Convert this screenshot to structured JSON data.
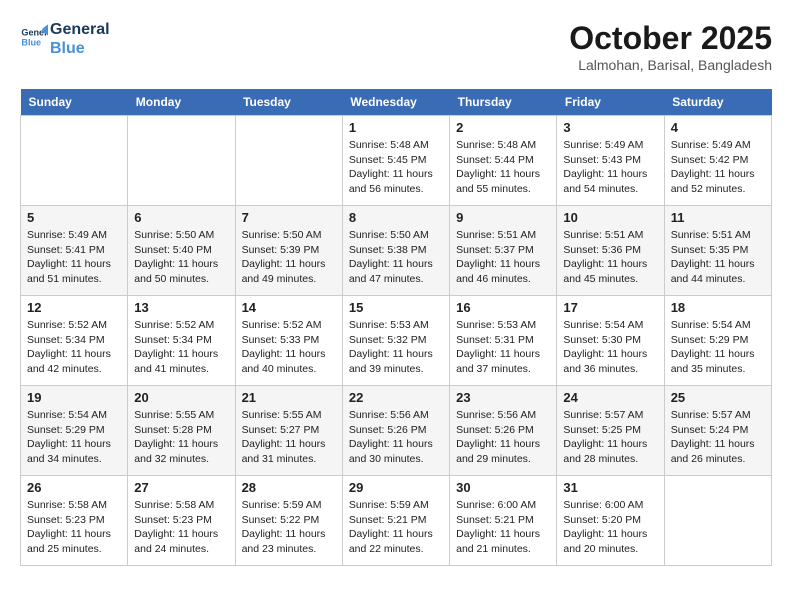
{
  "header": {
    "logo_line1": "General",
    "logo_line2": "Blue",
    "month": "October 2025",
    "location": "Lalmohan, Barisal, Bangladesh"
  },
  "weekdays": [
    "Sunday",
    "Monday",
    "Tuesday",
    "Wednesday",
    "Thursday",
    "Friday",
    "Saturday"
  ],
  "weeks": [
    [
      {
        "day": "",
        "info": ""
      },
      {
        "day": "",
        "info": ""
      },
      {
        "day": "",
        "info": ""
      },
      {
        "day": "1",
        "info": "Sunrise: 5:48 AM\nSunset: 5:45 PM\nDaylight: 11 hours\nand 56 minutes."
      },
      {
        "day": "2",
        "info": "Sunrise: 5:48 AM\nSunset: 5:44 PM\nDaylight: 11 hours\nand 55 minutes."
      },
      {
        "day": "3",
        "info": "Sunrise: 5:49 AM\nSunset: 5:43 PM\nDaylight: 11 hours\nand 54 minutes."
      },
      {
        "day": "4",
        "info": "Sunrise: 5:49 AM\nSunset: 5:42 PM\nDaylight: 11 hours\nand 52 minutes."
      }
    ],
    [
      {
        "day": "5",
        "info": "Sunrise: 5:49 AM\nSunset: 5:41 PM\nDaylight: 11 hours\nand 51 minutes."
      },
      {
        "day": "6",
        "info": "Sunrise: 5:50 AM\nSunset: 5:40 PM\nDaylight: 11 hours\nand 50 minutes."
      },
      {
        "day": "7",
        "info": "Sunrise: 5:50 AM\nSunset: 5:39 PM\nDaylight: 11 hours\nand 49 minutes."
      },
      {
        "day": "8",
        "info": "Sunrise: 5:50 AM\nSunset: 5:38 PM\nDaylight: 11 hours\nand 47 minutes."
      },
      {
        "day": "9",
        "info": "Sunrise: 5:51 AM\nSunset: 5:37 PM\nDaylight: 11 hours\nand 46 minutes."
      },
      {
        "day": "10",
        "info": "Sunrise: 5:51 AM\nSunset: 5:36 PM\nDaylight: 11 hours\nand 45 minutes."
      },
      {
        "day": "11",
        "info": "Sunrise: 5:51 AM\nSunset: 5:35 PM\nDaylight: 11 hours\nand 44 minutes."
      }
    ],
    [
      {
        "day": "12",
        "info": "Sunrise: 5:52 AM\nSunset: 5:34 PM\nDaylight: 11 hours\nand 42 minutes."
      },
      {
        "day": "13",
        "info": "Sunrise: 5:52 AM\nSunset: 5:34 PM\nDaylight: 11 hours\nand 41 minutes."
      },
      {
        "day": "14",
        "info": "Sunrise: 5:52 AM\nSunset: 5:33 PM\nDaylight: 11 hours\nand 40 minutes."
      },
      {
        "day": "15",
        "info": "Sunrise: 5:53 AM\nSunset: 5:32 PM\nDaylight: 11 hours\nand 39 minutes."
      },
      {
        "day": "16",
        "info": "Sunrise: 5:53 AM\nSunset: 5:31 PM\nDaylight: 11 hours\nand 37 minutes."
      },
      {
        "day": "17",
        "info": "Sunrise: 5:54 AM\nSunset: 5:30 PM\nDaylight: 11 hours\nand 36 minutes."
      },
      {
        "day": "18",
        "info": "Sunrise: 5:54 AM\nSunset: 5:29 PM\nDaylight: 11 hours\nand 35 minutes."
      }
    ],
    [
      {
        "day": "19",
        "info": "Sunrise: 5:54 AM\nSunset: 5:29 PM\nDaylight: 11 hours\nand 34 minutes."
      },
      {
        "day": "20",
        "info": "Sunrise: 5:55 AM\nSunset: 5:28 PM\nDaylight: 11 hours\nand 32 minutes."
      },
      {
        "day": "21",
        "info": "Sunrise: 5:55 AM\nSunset: 5:27 PM\nDaylight: 11 hours\nand 31 minutes."
      },
      {
        "day": "22",
        "info": "Sunrise: 5:56 AM\nSunset: 5:26 PM\nDaylight: 11 hours\nand 30 minutes."
      },
      {
        "day": "23",
        "info": "Sunrise: 5:56 AM\nSunset: 5:26 PM\nDaylight: 11 hours\nand 29 minutes."
      },
      {
        "day": "24",
        "info": "Sunrise: 5:57 AM\nSunset: 5:25 PM\nDaylight: 11 hours\nand 28 minutes."
      },
      {
        "day": "25",
        "info": "Sunrise: 5:57 AM\nSunset: 5:24 PM\nDaylight: 11 hours\nand 26 minutes."
      }
    ],
    [
      {
        "day": "26",
        "info": "Sunrise: 5:58 AM\nSunset: 5:23 PM\nDaylight: 11 hours\nand 25 minutes."
      },
      {
        "day": "27",
        "info": "Sunrise: 5:58 AM\nSunset: 5:23 PM\nDaylight: 11 hours\nand 24 minutes."
      },
      {
        "day": "28",
        "info": "Sunrise: 5:59 AM\nSunset: 5:22 PM\nDaylight: 11 hours\nand 23 minutes."
      },
      {
        "day": "29",
        "info": "Sunrise: 5:59 AM\nSunset: 5:21 PM\nDaylight: 11 hours\nand 22 minutes."
      },
      {
        "day": "30",
        "info": "Sunrise: 6:00 AM\nSunset: 5:21 PM\nDaylight: 11 hours\nand 21 minutes."
      },
      {
        "day": "31",
        "info": "Sunrise: 6:00 AM\nSunset: 5:20 PM\nDaylight: 11 hours\nand 20 minutes."
      },
      {
        "day": "",
        "info": ""
      }
    ]
  ]
}
